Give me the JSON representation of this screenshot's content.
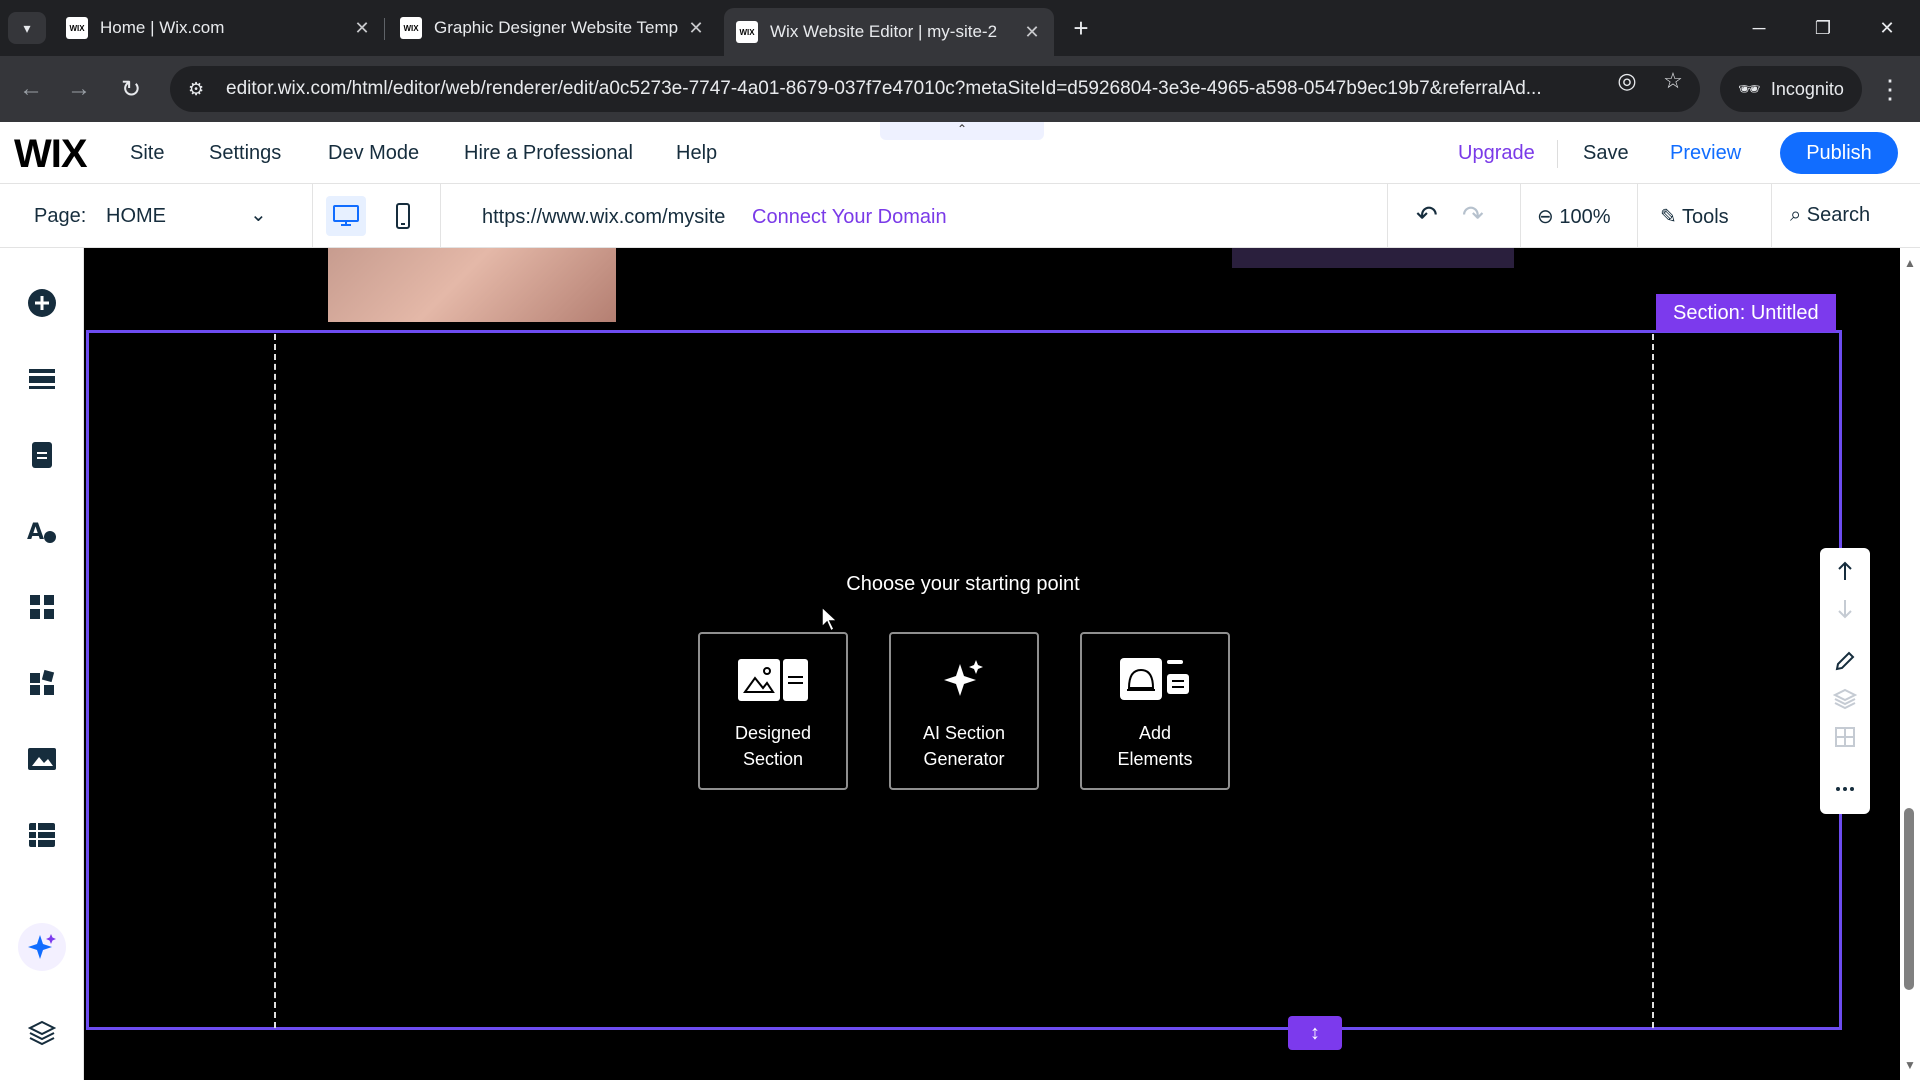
{
  "browser": {
    "tabs": [
      {
        "title": "Home | Wix.com",
        "favicon": "WIX"
      },
      {
        "title": "Graphic Designer Website Temp",
        "favicon": "WIX"
      },
      {
        "title": "Wix Website Editor | my-site-2",
        "favicon": "WIX"
      }
    ],
    "url": "editor.wix.com/html/editor/web/renderer/edit/a0c5273e-7747-4a01-8679-037f7e47010c?metaSiteId=d5926804-3e3e-4965-a598-0547b9ec19b7&referralAd...",
    "incognito_label": "Incognito"
  },
  "wix_top": {
    "logo": "WIX",
    "menu": [
      "Site",
      "Settings",
      "Dev Mode",
      "Hire a Professional",
      "Help"
    ],
    "upgrade": "Upgrade",
    "save": "Save",
    "preview": "Preview",
    "publish": "Publish"
  },
  "page_bar": {
    "label": "Page:",
    "page": "HOME",
    "site_url": "https://www.wix.com/mysite",
    "connect_domain": "Connect Your Domain",
    "zoom": "100%",
    "tools": "Tools",
    "search": "Search"
  },
  "canvas": {
    "section_label": "Section: Untitled",
    "prompt": "Choose your starting point",
    "cards": [
      {
        "line1": "Designed",
        "line2": "Section",
        "icon": "designed-section-icon"
      },
      {
        "line1": "AI Section",
        "line2": "Generator",
        "icon": "sparkle-icon"
      },
      {
        "line1": "Add",
        "line2": "Elements",
        "icon": "add-elements-icon"
      }
    ]
  },
  "colors": {
    "accent_purple": "#7c3aed",
    "wix_blue": "#116dff",
    "upgrade_purple": "#7a3ae8"
  }
}
